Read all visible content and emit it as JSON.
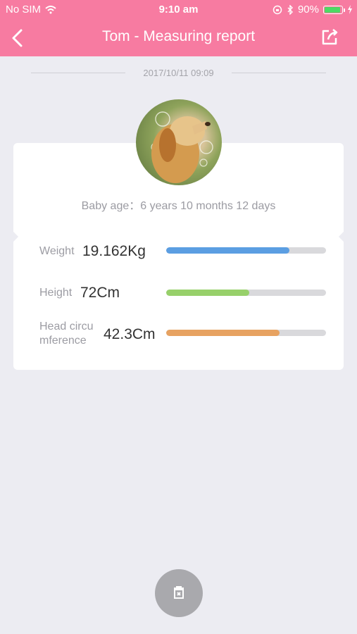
{
  "status_bar": {
    "carrier": "No SIM",
    "time": "9:10 am",
    "battery_percent": "90%",
    "battery_level": 0.9,
    "icons": [
      "wifi-icon",
      "lock-rotation-icon",
      "bluetooth-icon",
      "charging-icon"
    ]
  },
  "nav": {
    "title": "Tom - Measuring report",
    "back_icon": "chevron-left-icon",
    "share_icon": "share-icon"
  },
  "report": {
    "date": "2017/10/11 09:09",
    "baby_age": "Baby age：6 years 10 months 12 days"
  },
  "metrics": [
    {
      "label": "Weight",
      "value": "19.162Kg",
      "progress": 0.77,
      "color": "#5b9ee2"
    },
    {
      "label": "Height",
      "value": "72Cm",
      "progress": 0.52,
      "color": "#97d06a"
    },
    {
      "label_line1": "Head circu",
      "label_line2": "mference",
      "value": "42.3Cm",
      "progress": 0.71,
      "color": "#e7a261"
    }
  ],
  "footer": {
    "delete_icon": "delete-icon"
  },
  "colors": {
    "accent": "#f77ba1",
    "background": "#ececf2"
  }
}
